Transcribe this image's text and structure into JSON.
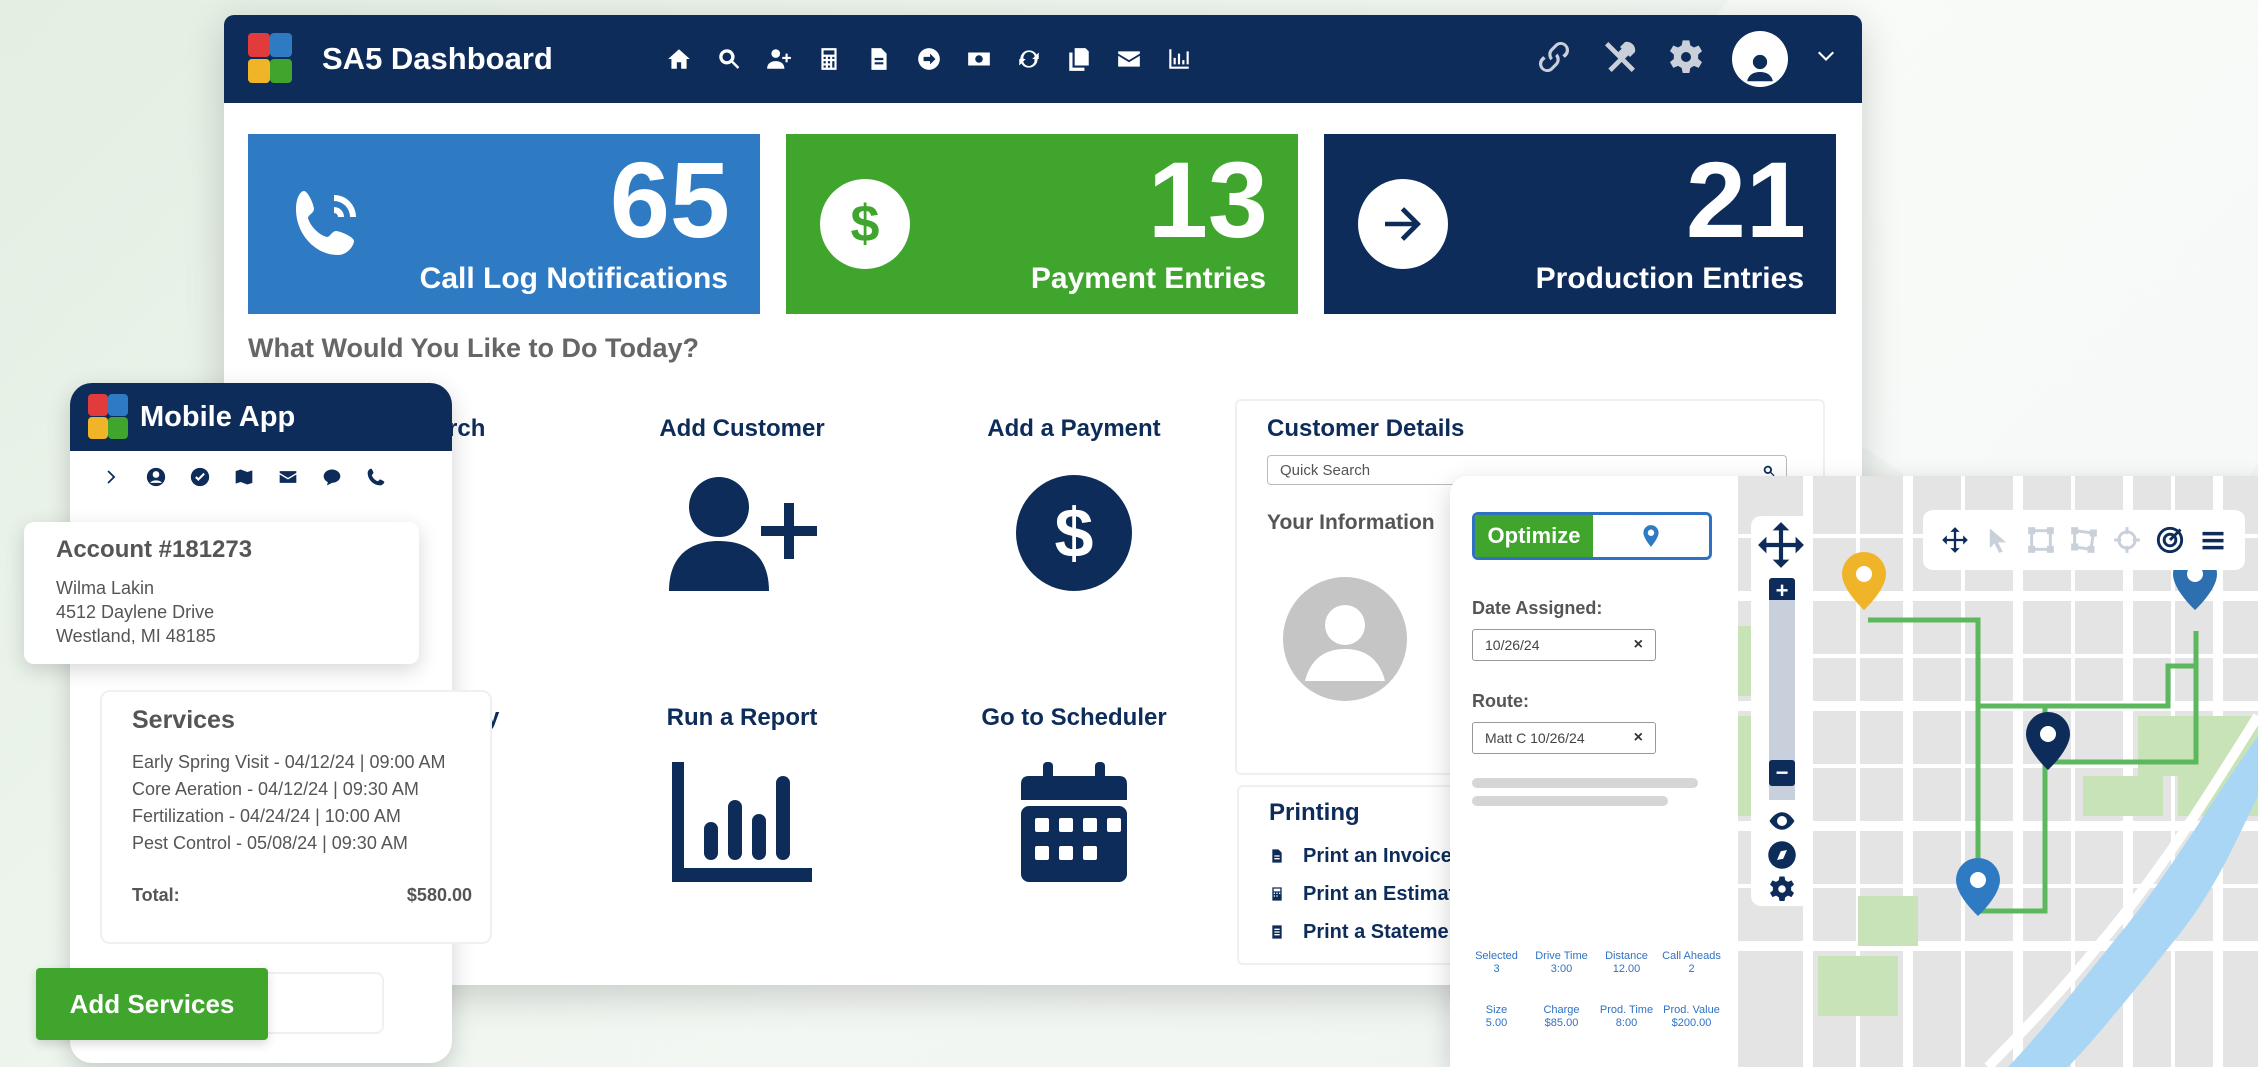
{
  "header": {
    "app_title": "SA5 Dashboard",
    "nav_icons": [
      "home-icon",
      "search-icon",
      "add-user-icon",
      "calculator-icon",
      "document-icon",
      "arrow-circle-icon",
      "cash-icon",
      "refresh-icon",
      "copy-icon",
      "mail-icon",
      "chart-icon"
    ],
    "right_icons": [
      "link-icon",
      "tools-icon",
      "gear-icon",
      "avatar",
      "chevron-down-icon"
    ]
  },
  "stats": [
    {
      "value": "65",
      "label": "Call Log Notifications",
      "color": "#2e7bc4",
      "icon": "phone-icon"
    },
    {
      "value": "13",
      "label": "Payment Entries",
      "color": "#3fa52d",
      "icon": "dollar-icon"
    },
    {
      "value": "21",
      "label": "Production Entries",
      "color": "#0d2c5a",
      "icon": "arrow-right-icon"
    }
  ],
  "main": {
    "question": "What Would You Like to Do Today?",
    "actions": {
      "search_partial": "rch",
      "add_customer": "Add Customer",
      "add_payment": "Add a Payment",
      "activity_partial": "y",
      "run_report": "Run a Report",
      "go_scheduler": "Go to Scheduler"
    }
  },
  "customer_details": {
    "title": "Customer Details",
    "search_placeholder": "Quick Search",
    "your_information": "Your Information"
  },
  "printing": {
    "title": "Printing",
    "items": [
      "Print an Invoice",
      "Print an Estimate",
      "Print a Statemen"
    ]
  },
  "mobile": {
    "title": "Mobile App",
    "icons": [
      "chevron-right-icon",
      "user-icon",
      "check-icon",
      "map-icon",
      "mail-icon",
      "chat-icon",
      "phone-icon"
    ]
  },
  "account": {
    "title": "Account #181273",
    "name": "Wilma Lakin",
    "street": "4512 Daylene Drive",
    "city": "Westland, MI 48185"
  },
  "services": {
    "title": "Services",
    "items": [
      "Early Spring Visit - 04/12/24 | 09:00 AM",
      "Core Aeration - 04/12/24 | 09:30 AM",
      "Fertilization - 04/24/24 | 10:00 AM",
      "Pest Control - 05/08/24 | 09:30 AM"
    ],
    "total_label": "Total:",
    "total_value": "$580.00",
    "add_button": "Add Services"
  },
  "route": {
    "optimize_label": "Optimize",
    "date_label": "Date Assigned:",
    "date_value": "10/26/24",
    "route_label": "Route:",
    "route_value": "Matt C 10/26/24",
    "clear_symbol": "×",
    "stats_row1": [
      {
        "label": "Selected",
        "value": "3"
      },
      {
        "label": "Drive Time",
        "value": "3:00"
      },
      {
        "label": "Distance",
        "value": "12.00"
      },
      {
        "label": "Call Aheads",
        "value": "2"
      }
    ],
    "stats_row2": [
      {
        "label": "Size",
        "value": "5.00"
      },
      {
        "label": "Charge",
        "value": "$85.00"
      },
      {
        "label": "Prod. Time",
        "value": "8:00"
      },
      {
        "label": "Prod. Value",
        "value": "$200.00"
      }
    ],
    "zoom_plus": "+",
    "zoom_minus": "−",
    "map_tools": [
      "move-icon",
      "pointer-icon",
      "square-select-icon",
      "polygon-select-icon",
      "crosshair-icon",
      "target-icon",
      "menu-icon"
    ],
    "colors": {
      "route_line": "#5cb85c",
      "pin_navy": "#0d2c5a",
      "pin_blue": "#2e7bc4",
      "pin_yellow": "#f0b429",
      "water": "#a9d6f5",
      "park": "#c9e3b8"
    }
  }
}
